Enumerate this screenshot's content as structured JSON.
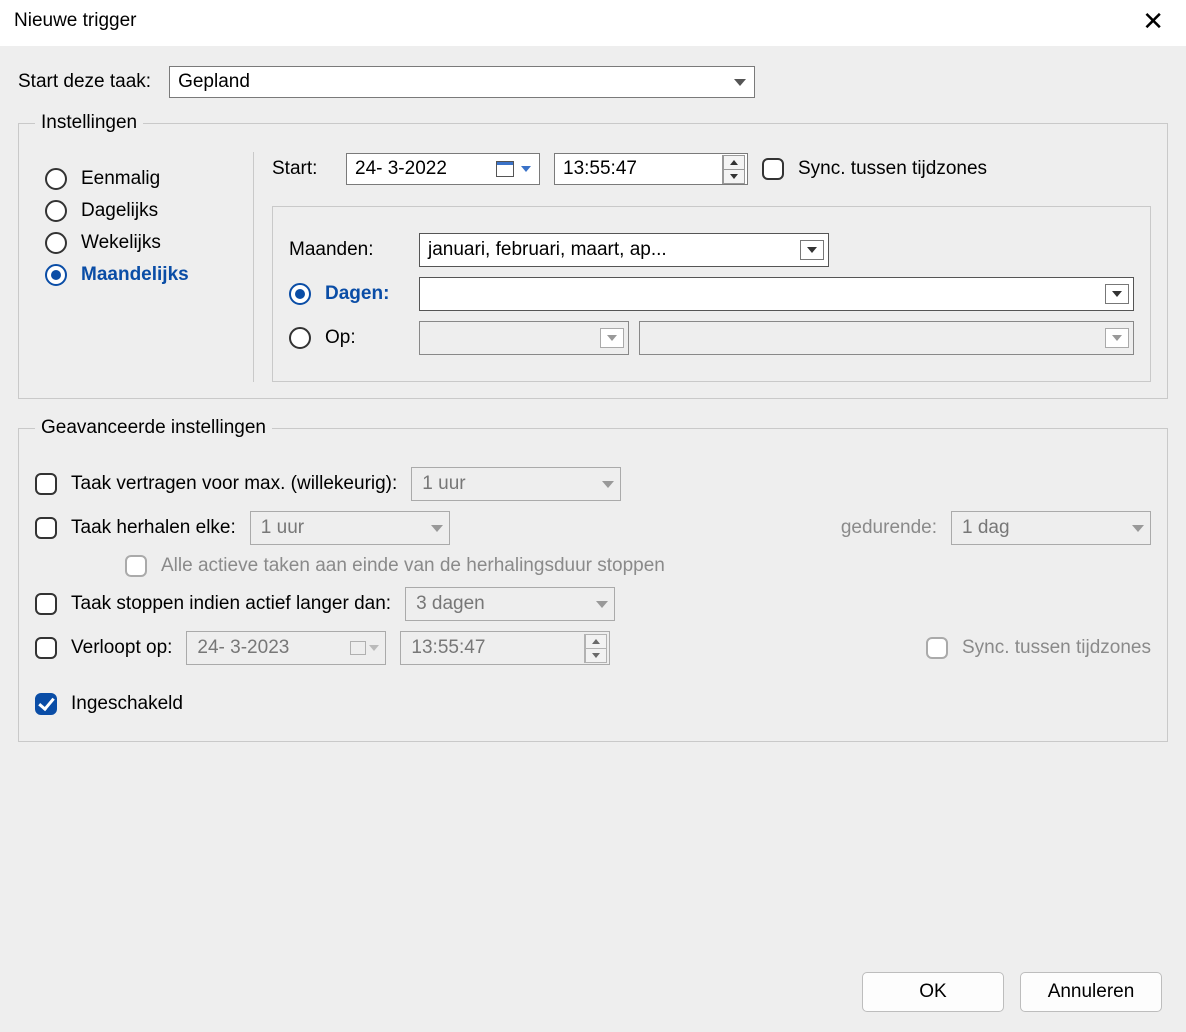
{
  "title": "Nieuwe trigger",
  "startTask": {
    "label": "Start deze taak:",
    "value": "Gepland"
  },
  "settings": {
    "legend": "Instellingen",
    "freq": {
      "once": "Eenmalig",
      "daily": "Dagelijks",
      "weekly": "Wekelijks",
      "monthly": "Maandelijks"
    },
    "start": {
      "label": "Start:",
      "date": "24-  3-2022",
      "time": "13:55:47"
    },
    "sync": "Sync. tussen tijdzones",
    "monthly": {
      "monthsLabel": "Maanden:",
      "monthsValue": "januari, februari, maart, ap...",
      "daysLabel": "Dagen:",
      "daysValue": "",
      "onLabel": "Op:",
      "onValue1": "",
      "onValue2": ""
    }
  },
  "advanced": {
    "legend": "Geavanceerde instellingen",
    "delayLabel": "Taak vertragen voor max. (willekeurig):",
    "delayValue": "1 uur",
    "repeatLabel": "Taak herhalen elke:",
    "repeatValue": "1 uur",
    "forLabel": "gedurende:",
    "forValue": "1 dag",
    "stopAllLabel": "Alle actieve taken aan einde van de herhalingsduur stoppen",
    "stopIfLabel": "Taak stoppen indien actief langer dan:",
    "stopIfValue": "3 dagen",
    "expireLabel": "Verloopt op:",
    "expireDate": "24-  3-2023",
    "expireTime": "13:55:47",
    "expireSync": "Sync. tussen tijdzones",
    "enabledLabel": "Ingeschakeld"
  },
  "buttons": {
    "ok": "OK",
    "cancel": "Annuleren"
  }
}
